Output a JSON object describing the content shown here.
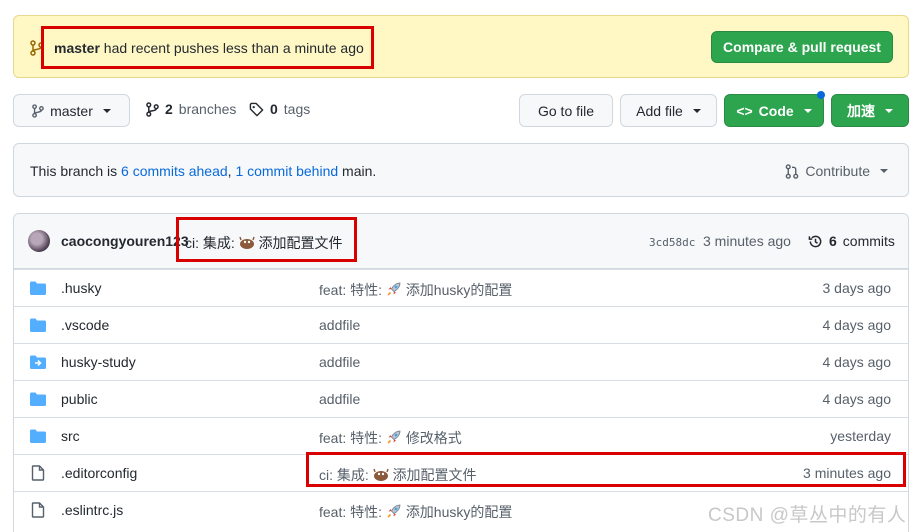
{
  "banner": {
    "branch": "master",
    "text": " had recent pushes less than a minute ago",
    "compare_button": "Compare & pull request"
  },
  "toolbar": {
    "branch_select": "master",
    "branches_count": "2",
    "branches_label": "branches",
    "tags_count": "0",
    "tags_label": "tags",
    "goto_file": "Go to file",
    "add_file": "Add file",
    "code": "Code",
    "accelerate": "加速"
  },
  "ahead_bar": {
    "prefix": "This branch is ",
    "ahead_link": "6 commits ahead",
    "sep": ", ",
    "behind_link": "1 commit behind",
    "suffix": " main.",
    "contribute": "Contribute"
  },
  "latest_commit": {
    "author": "caocongyouren123",
    "message": "ci: 集成: ",
    "message_tail": "添加配置文件",
    "hash": "3cd58dc",
    "time": "3 minutes ago",
    "count": "6",
    "count_label": "commits"
  },
  "files": [
    {
      "type": "folder",
      "name": ".husky",
      "message": "feat: 特性: ",
      "emoji": "rocket",
      "message_tail": "添加husky的配置",
      "time": "3 days ago"
    },
    {
      "type": "folder",
      "name": ".vscode",
      "message": "addfile",
      "emoji": "",
      "message_tail": "",
      "time": "4 days ago"
    },
    {
      "type": "submodule",
      "name": "husky-study",
      "message": "addfile",
      "emoji": "",
      "message_tail": "",
      "time": "4 days ago"
    },
    {
      "type": "folder",
      "name": "public",
      "message": "addfile",
      "emoji": "",
      "message_tail": "",
      "time": "4 days ago"
    },
    {
      "type": "folder",
      "name": "src",
      "message": "feat: 特性: ",
      "emoji": "rocket",
      "message_tail": "修改格式",
      "time": "yesterday"
    },
    {
      "type": "file",
      "name": ".editorconfig",
      "message": "ci: 集成: ",
      "emoji": "ferris",
      "message_tail": "添加配置文件",
      "time": "3 minutes ago"
    },
    {
      "type": "file",
      "name": ".eslintrc.js",
      "message": "feat: 特性: ",
      "emoji": "rocket",
      "message_tail": "添加husky的配置",
      "time": ""
    }
  ],
  "watermark": "CSDN @草丛中的有人",
  "colors": {
    "green": "#2da44e",
    "link": "#0969da",
    "highlight": "#d90000",
    "banner_bg": "#fff8c5"
  }
}
